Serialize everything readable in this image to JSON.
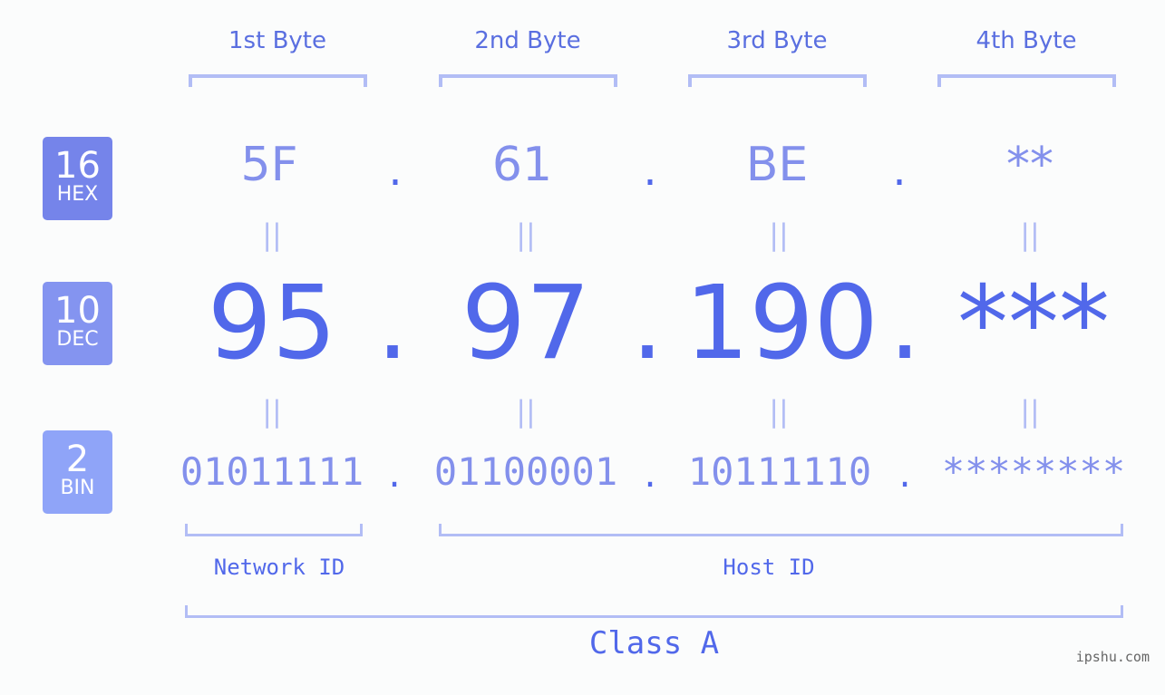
{
  "bytes": [
    {
      "label": "1st Byte",
      "hex": "5F",
      "dec": "95",
      "bin": "01011111"
    },
    {
      "label": "2nd Byte",
      "hex": "61",
      "dec": "97",
      "bin": "01100001"
    },
    {
      "label": "3rd Byte",
      "hex": "BE",
      "dec": "190",
      "bin": "10111110"
    },
    {
      "label": "4th Byte",
      "hex": "**",
      "dec": "***",
      "bin": "********"
    }
  ],
  "separator": ".",
  "equals": "||",
  "badges": {
    "hex": {
      "num": "16",
      "text": "HEX",
      "color": "#7584ea"
    },
    "dec": {
      "num": "10",
      "text": "DEC",
      "color": "#8494f0"
    },
    "bin": {
      "num": "2",
      "text": "BIN",
      "color": "#8fa4f8"
    }
  },
  "network_id_label": "Network ID",
  "host_id_label": "Host ID",
  "class_label": "Class A",
  "watermark": "ipshu.com",
  "colors": {
    "primary": "#5168ea",
    "light": "#8390ec",
    "bracket": "#b2bdf5"
  }
}
